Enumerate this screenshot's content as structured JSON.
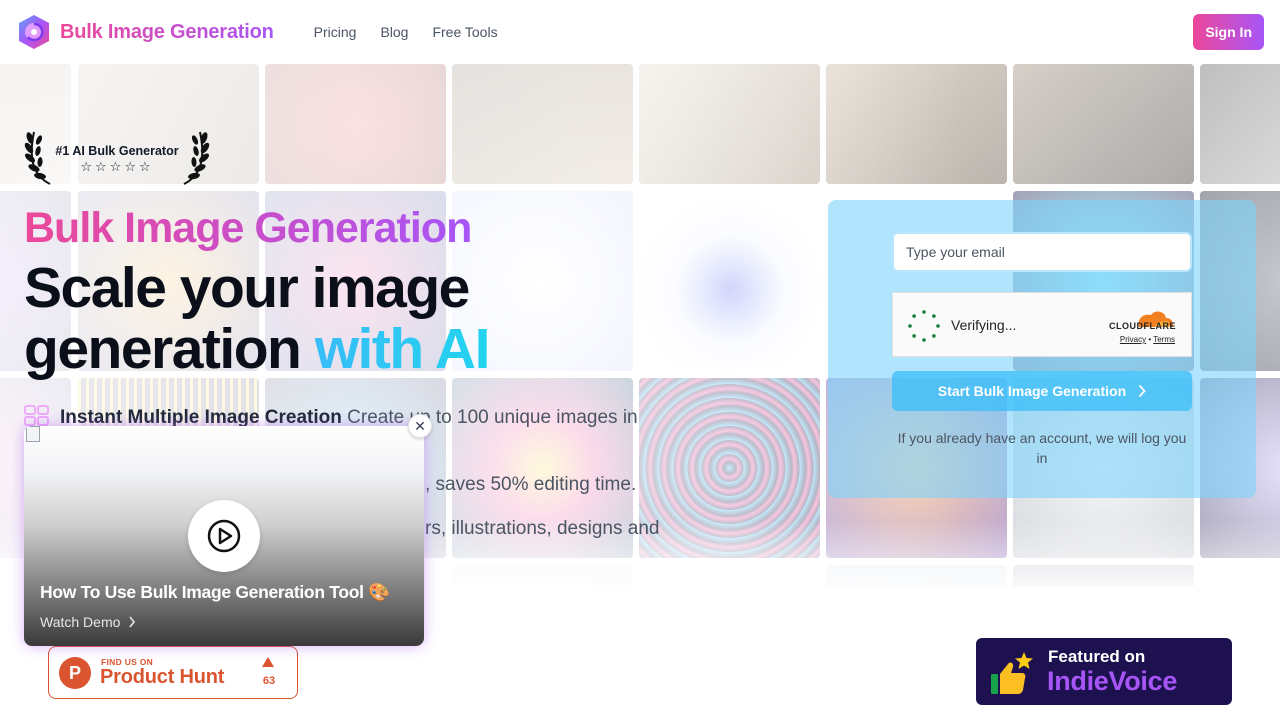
{
  "header": {
    "brand": "Bulk Image Generation",
    "nav": [
      "Pricing",
      "Blog",
      "Free Tools"
    ],
    "signin_label": "Sign In"
  },
  "award": {
    "text": "#1 AI Bulk Generator",
    "stars": "☆☆☆☆☆"
  },
  "hero": {
    "tagline": "Bulk Image Generation",
    "heading_part1": "Scale your image generation ",
    "heading_accent": "with AI",
    "features": [
      {
        "title": "Instant Multiple Image Creation",
        "text": " Create up to 100 unique images in"
      },
      {
        "title": "",
        "text": ", saves 50% editing time."
      },
      {
        "title": "",
        "text": "rs, illustrations, designs and"
      }
    ]
  },
  "video": {
    "title": "How To Use Bulk Image Generation Tool 🎨",
    "link": "Watch Demo",
    "close": "✕"
  },
  "signup": {
    "email_placeholder": "Type your email",
    "verifying": "Verifying...",
    "cloudflare_word": "CLOUDFLARE",
    "cf_privacy": "Privacy",
    "cf_sep": " • ",
    "cf_terms": "Terms",
    "start_label": "Start Bulk Image Generation",
    "note": "If you already have an account, we will log you in"
  },
  "producthunt": {
    "small": "FIND US ON",
    "big": "Product Hunt",
    "count": "63",
    "logo_letter": "P"
  },
  "indievoice": {
    "small": "Featured on",
    "big": "IndieVoice"
  },
  "colors": {
    "brand_pink": "#ec4899",
    "brand_purple": "#a855f7",
    "accent_cyan": "#38bdf8",
    "producthunt": "#da552f",
    "indievoice_bg": "#1e1150"
  }
}
